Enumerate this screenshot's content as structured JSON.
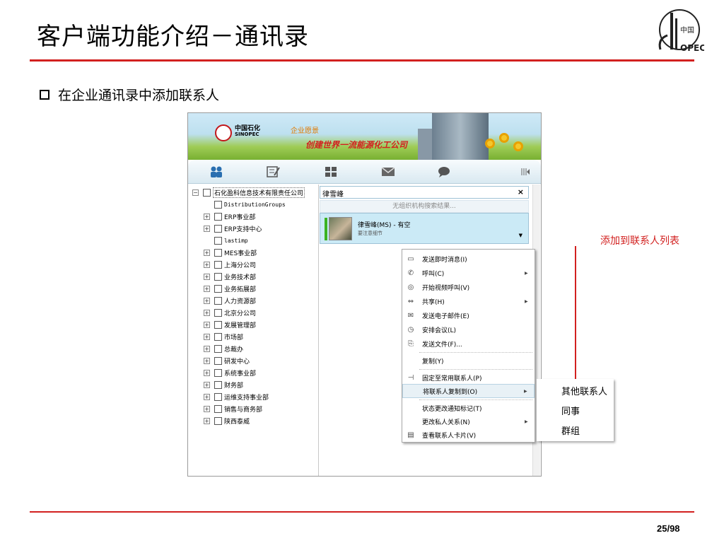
{
  "slide": {
    "title": "客户端功能介绍－通讯录",
    "bullet": "在企业通讯录中添加联系人",
    "annotation": "添加到联系人列表",
    "page": "25/98"
  },
  "app": {
    "banner": {
      "brand_cn": "中国石化",
      "brand_en": "SINOPEC",
      "vision_label": "企业愿景",
      "vision_text": "创建世界一流能源化工公司"
    },
    "tree": {
      "root": "石化盈科信息技术有限责任公司",
      "items": [
        "DistributionGroups",
        "ERP事业部",
        "ERP支持中心",
        "lastimp",
        "MES事业部",
        "上海分公司",
        "业务技术部",
        "业务拓展部",
        "人力资源部",
        "北京分公司",
        "发展管理部",
        "市场部",
        "总裁办",
        "研发中心",
        "系统事业部",
        "财务部",
        "运维支持事业部",
        "销售与商务部",
        "陕西泰威"
      ]
    },
    "search": {
      "value": "律雪峰",
      "close": "×",
      "no_results": "无组织机构搜索结果..."
    },
    "contact": {
      "name": "律雪峰(MS) - 有空",
      "note": "要注意细节"
    },
    "context_menu": [
      {
        "icon": "chat-icon",
        "glyph": "▭",
        "label": "发送即时消息(I)",
        "submenu": false
      },
      {
        "icon": "phone-icon",
        "glyph": "✆",
        "label": "呼叫(C)",
        "submenu": true
      },
      {
        "icon": "video-icon",
        "glyph": "◎",
        "label": "开始视频呼叫(V)",
        "submenu": false
      },
      {
        "icon": "share-icon",
        "glyph": "⇔",
        "label": "共享(H)",
        "submenu": true
      },
      {
        "icon": "mail-icon",
        "glyph": "✉",
        "label": "发送电子邮件(E)",
        "submenu": false
      },
      {
        "icon": "meeting-icon",
        "glyph": "◷",
        "label": "安排会议(L)",
        "submenu": false
      },
      {
        "icon": "paperclip-icon",
        "glyph": "⎘",
        "label": "发送文件(F)...",
        "submenu": false
      },
      {
        "icon": "",
        "glyph": "",
        "label": "复制(Y)",
        "submenu": false
      },
      {
        "icon": "pin-icon",
        "glyph": "⊣",
        "label": "固定至常用联系人(P)",
        "submenu": false
      },
      {
        "icon": "",
        "glyph": "",
        "label": "将联系人复制到(O)",
        "submenu": true
      },
      {
        "icon": "",
        "glyph": "",
        "label": "状态更改通知标记(T)",
        "submenu": false
      },
      {
        "icon": "",
        "glyph": "",
        "label": "更改私人关系(N)",
        "submenu": true
      },
      {
        "icon": "contact-card-icon",
        "glyph": "▤",
        "label": "查看联系人卡片(V)",
        "submenu": false
      }
    ],
    "submenu": [
      "其他联系人",
      "同事",
      "群组"
    ]
  }
}
